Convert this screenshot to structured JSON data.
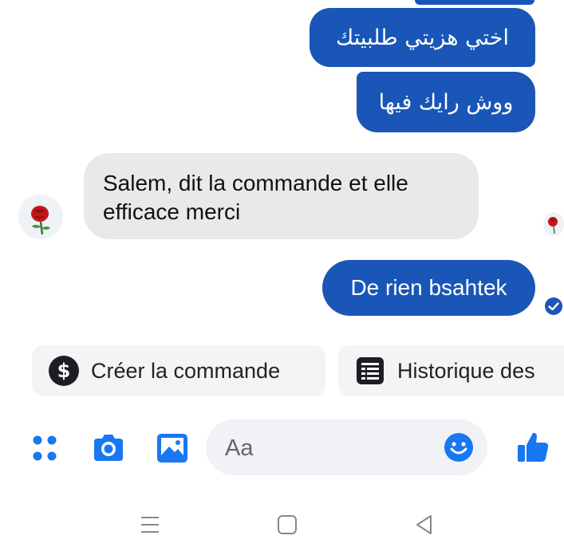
{
  "messages": [
    {
      "direction": "outgoing",
      "text": "اختي هزيتي طلبيتك"
    },
    {
      "direction": "outgoing",
      "text": "ووش رايك فيها"
    },
    {
      "direction": "incoming",
      "text": "Salem, dit la commande et elle efficace merci"
    },
    {
      "direction": "outgoing",
      "text": "De rien bsahtek"
    }
  ],
  "quick_replies": [
    {
      "label": "Créer la commande",
      "icon": "dollar-icon"
    },
    {
      "label": "Historique des",
      "icon": "list-icon"
    }
  ],
  "composer": {
    "placeholder": "Aa"
  },
  "toolbar": {
    "icons": [
      "grid-menu-icon",
      "camera-icon",
      "gallery-icon",
      "emoji-icon",
      "thumbs-up-icon"
    ]
  },
  "nav": {
    "icons": [
      "recents-icon",
      "home-icon",
      "back-icon"
    ]
  },
  "colors": {
    "accent": "#1a56b8",
    "incoming_bubble": "#e9e9eb",
    "icon_blue": "#1877f2",
    "chip_bg": "#f2f4f6",
    "composer_bg": "#f0f2f5"
  }
}
